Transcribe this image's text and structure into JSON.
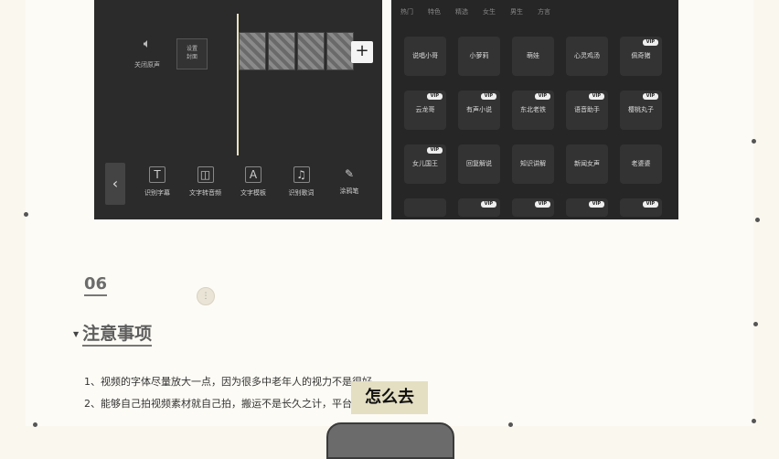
{
  "editor": {
    "audio_label": "关闭原声",
    "tag_line1": "设置",
    "tag_line2": "封面",
    "add_symbol": "+",
    "back_symbol": "‹",
    "tools": [
      {
        "icon": "subtitle-icon",
        "glyph": "T",
        "label": "识别字幕"
      },
      {
        "icon": "text-to-speech-icon",
        "glyph": "◫",
        "label": "文字转音频"
      },
      {
        "icon": "text-template-icon",
        "glyph": "A",
        "label": "文字模板"
      },
      {
        "icon": "lyrics-icon",
        "glyph": "♫",
        "label": "识别歌词"
      },
      {
        "icon": "pen-icon",
        "glyph": "✎",
        "label": "涂鸦笔"
      }
    ]
  },
  "voices": {
    "top_tabs": [
      "热门",
      "特色",
      "精选",
      "女生",
      "男生",
      "方言"
    ],
    "vip_badge": "VIP",
    "rows": [
      [
        {
          "label": "说唱小哥",
          "vip": false
        },
        {
          "label": "小萝莉",
          "vip": false
        },
        {
          "label": "萌娃",
          "vip": false
        },
        {
          "label": "心灵鸡汤",
          "vip": false
        },
        {
          "label": "佩奇猪",
          "vip": true
        }
      ],
      [
        {
          "label": "云龙哥",
          "vip": true
        },
        {
          "label": "有声小说",
          "vip": true
        },
        {
          "label": "东北老铁",
          "vip": true
        },
        {
          "label": "语音助手",
          "vip": true
        },
        {
          "label": "樱桃丸子",
          "vip": true
        }
      ],
      [
        {
          "label": "女儿国王",
          "vip": true
        },
        {
          "label": "回复解说",
          "vip": false
        },
        {
          "label": "知识讲解",
          "vip": false
        },
        {
          "label": "新闻女声",
          "vip": false
        },
        {
          "label": "老婆婆",
          "vip": false
        }
      ],
      [
        {
          "label": "",
          "vip": false
        },
        {
          "label": "",
          "vip": true
        },
        {
          "label": "",
          "vip": true
        },
        {
          "label": "",
          "vip": true
        },
        {
          "label": "",
          "vip": true
        }
      ]
    ]
  },
  "document": {
    "section_number": "06",
    "loader_glyph": "⋮",
    "caret": "▼",
    "heading": "注意事项",
    "items": [
      "1、视频的字体尽量放大一点，因为很多中老年人的视力不是很好。",
      "2、能够自己拍视频素材就自己拍，搬运不是长久之计，平台会检测到。"
    ]
  },
  "caption": "怎么去"
}
